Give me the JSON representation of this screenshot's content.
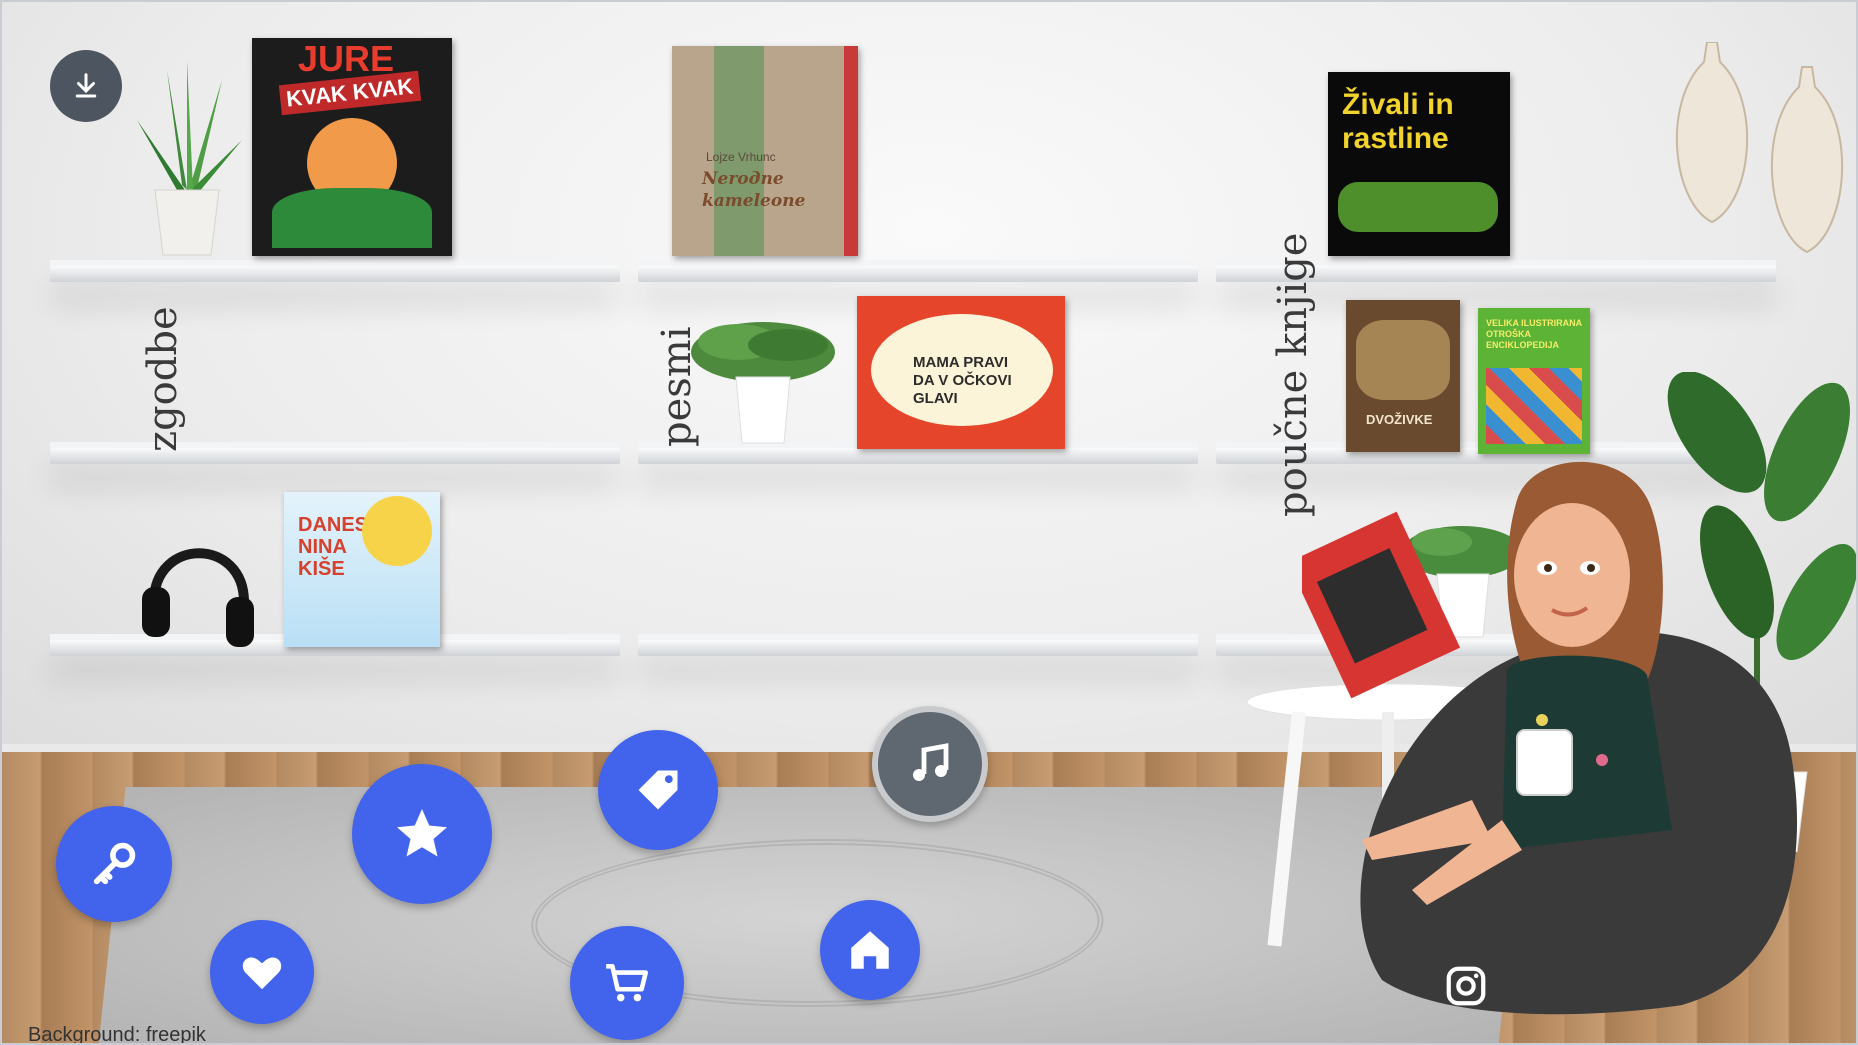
{
  "categories": {
    "stories": "zgodbe",
    "poems": "pesmi",
    "educational": "poučne knjige"
  },
  "books": {
    "jure": {
      "title": "JURE",
      "subtitle": "KVAK KVAK"
    },
    "nerodni": {
      "author": "Lojze Vrhunc",
      "title": "Neroдne kameleone"
    },
    "zivali": {
      "title": "Živali in rastline"
    },
    "mama": {
      "title": "MAMA PRAVI DA V OČKOVI GLAVI"
    },
    "dvozivke": {
      "title": "DVOŽIVKE"
    },
    "enciklopedija": {
      "title": "VELIKA ILUSTRIRANA OTROŠKA ENCIKLOPEDIJA"
    },
    "nina": {
      "title": "DANES NINA KIŠE"
    }
  },
  "buttons": {
    "download": "download-icon",
    "key": "key-icon",
    "star": "star-icon",
    "tag": "tag-icon",
    "music": "music-note-icon",
    "heart": "heart-icon",
    "cart": "cart-icon",
    "home": "home-icon",
    "instagram": "instagram-icon"
  },
  "colors": {
    "button_blue": "#4263eb",
    "music_gray": "#5f6770"
  },
  "credit": "Background: freepik"
}
